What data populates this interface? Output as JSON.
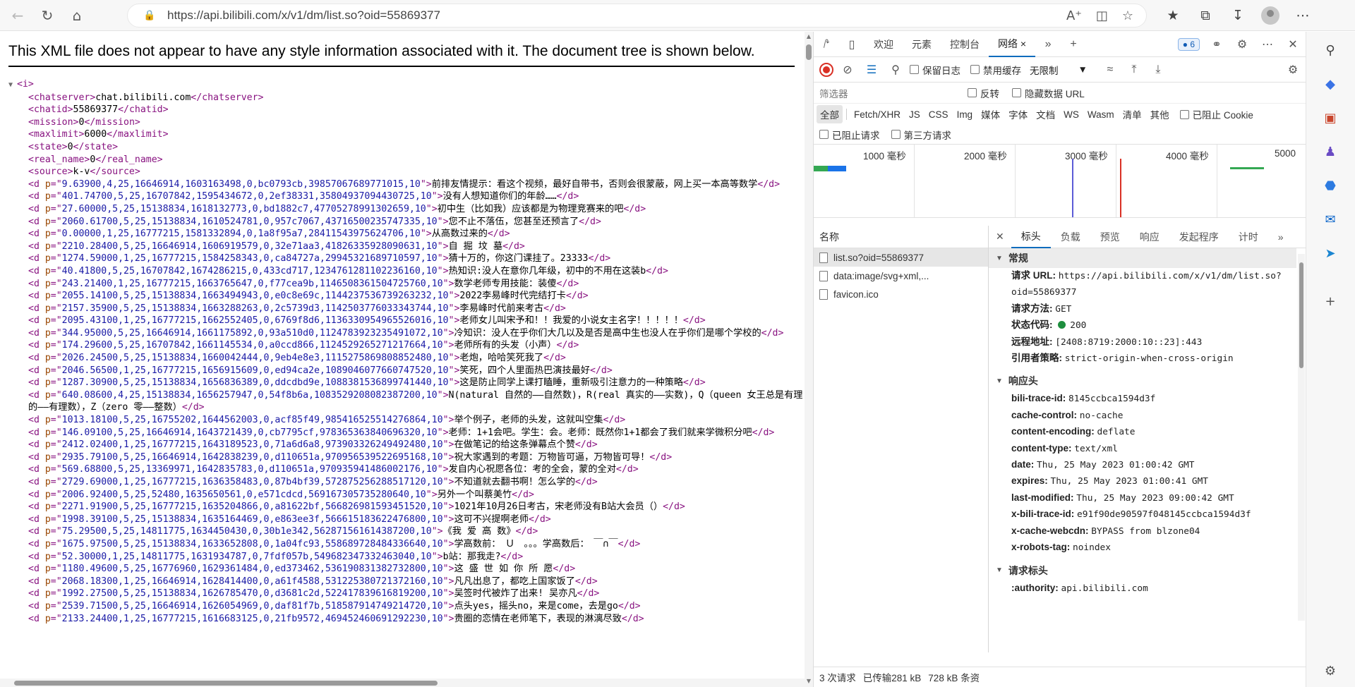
{
  "browser": {
    "url": "https://api.bilibili.com/x/v1/dm/list.so?oid=55869377"
  },
  "xml": {
    "notice": "This XML file does not appear to have any style information associated with it. The document tree is shown below.",
    "root_tag": "i",
    "meta": [
      {
        "tag": "chatserver",
        "value": "chat.bilibili.com"
      },
      {
        "tag": "chatid",
        "value": "55869377"
      },
      {
        "tag": "mission",
        "value": "0"
      },
      {
        "tag": "maxlimit",
        "value": "6000"
      },
      {
        "tag": "state",
        "value": "0"
      },
      {
        "tag": "real_name",
        "value": "0"
      },
      {
        "tag": "source",
        "value": "k-v"
      }
    ],
    "danmaku": [
      {
        "p": "9.63900,4,25,16646914,1603163498,0,bc0793cb,39857067689771015,10",
        "text": "前排友情提示：看这个视频，最好自带书，否则会很蒙蔽，网上买一本高等数学"
      },
      {
        "p": "401.74700,5,25,16707842,1595434672,0,2ef38331,35804937094430725,10",
        "text": "没有人想知道你们的年龄……"
      },
      {
        "p": "27.60000,5,25,15138834,1618132773,0,bd1882c7,47705278991302659,10",
        "text": "初中生（比如我）应该都是为物理竞赛来的吧"
      },
      {
        "p": "2060.61700,5,25,15138834,1610524781,0,957c7067,43716500235747335,10",
        "text": "您不止不落伍，您甚至还预言了"
      },
      {
        "p": "0.00000,1,25,16777215,1581332894,0,1a8f95a7,28411543975624706,10",
        "text": "从高数过来的"
      },
      {
        "p": "2210.28400,5,25,16646914,1606919579,0,32e71aa3,41826335928090631,10",
        "text": "自 掘 坟 墓"
      },
      {
        "p": "1274.59000,1,25,16777215,1584258343,0,ca84727a,29945321689710597,10",
        "text": "猜十万的，你这门课挂了。23333"
      },
      {
        "p": "40.41800,5,25,16707842,1674286215,0,433cd717,1234761281102236160,10",
        "text": "热知识:没人在意你几年级，初中的不用在这装b"
      },
      {
        "p": "243.21400,1,25,16777215,1663765647,0,f77cea9b,1146508361504725760,10",
        "text": "数学老师专用技能：装傻"
      },
      {
        "p": "2055.14100,5,25,15138834,1663494943,0,e0c8e69c,1144237536739263232,10",
        "text": "2022李易峰时代完结打卡"
      },
      {
        "p": "2157.35900,5,25,15138834,1663288263,0,2c5739d3,1142503776033343744,10",
        "text": "李易峰时代前来考古"
      },
      {
        "p": "2095.43100,1,25,16777215,1662552405,0,6769f8d6,1136330954965526016,10",
        "text": "老师女儿叫宋予和！！我爱的小说女主名字！！！！！"
      },
      {
        "p": "344.95000,5,25,16646914,1661175892,0,93a510d0,1124783923235491072,10",
        "text": "冷知识：没人在乎你们大几以及是否是高中生也没人在乎你们是哪个学校的"
      },
      {
        "p": "174.29600,5,25,16707842,1661145534,0,a0ccd866,1124529265271217664,10",
        "text": "老师所有的头发（小声）"
      },
      {
        "p": "2026.24500,5,25,15138834,1660042444,0,9eb4e8e3,1115275869808852480,10",
        "text": "老炮，哈哈笑死我了"
      },
      {
        "p": "2046.56500,1,25,16777215,1656915609,0,ed94ca2e,1089046077660747520,10",
        "text": "笑死，四个人里面热巴演技最好"
      },
      {
        "p": "1287.30900,5,25,15138834,1656836389,0,ddcdbd9e,1088381536899741440,10",
        "text": "这是防止同学上课打瞌睡，重新吸引注意力的一种策略"
      },
      {
        "p": "640.08600,4,25,15138834,1656257947,0,54f8b6a,1083529208082387200,10",
        "text": "N(natural 自然的——自然数)，R(real 真实的——实数)，Q（queen 女王总是有理的——有理数），Z（zero 零——整数）"
      },
      {
        "p": "1013.18100,5,25,16755202,1644562003,0,acf85f49,985416525514276864,10",
        "text": "举个例子，老师的头发，这就叫空集"
      },
      {
        "p": "146.09100,5,25,16646914,1643721439,0,cb7795cf,978365363840696320,10",
        "text": "老师：1+1会吧。学生：会。老师：既然你1+1都会了我们就来学微积分吧"
      },
      {
        "p": "2412.02400,1,25,16777215,1643189523,0,71a6d6a8,973903326249492480,10",
        "text": "在做笔记的给这条弹幕点个赞"
      },
      {
        "p": "2935.79100,5,25,16646914,1642838239,0,d110651a,970956539522695168,10",
        "text": "祝大家遇到的考题：万物皆可逼，万物皆可导！"
      },
      {
        "p": "569.68800,5,25,13369971,1642835783,0,d110651a,970935941486002176,10",
        "text": "发自内心祝愿各位：考的全会，蒙的全对"
      },
      {
        "p": "2729.69000,1,25,16777215,1636358483,0,87b4bf39,572875256288517120,10",
        "text": "不知道就去翻书啊！怎么学的"
      },
      {
        "p": "2006.92400,5,25,52480,1635650561,0,e571cdcd,569167305735280640,10",
        "text": "另外一个叫蔡美竹"
      },
      {
        "p": "2271.91900,5,25,16777215,1635204866,0,a81622bf,566826981593451520,10",
        "text": "1021年10月26日考古，宋老师没有B站大会员（）"
      },
      {
        "p": "1998.39100,5,25,15138834,1635164469,0,e863ee3f,566615183622476800,10",
        "text": "这可不兴提啊老师"
      },
      {
        "p": "75.29500,5,25,14811775,1634450430,0,30b1e342,562871561614387200,10",
        "text": "《我 爱 高 数》"
      },
      {
        "p": "1675.97500,5,25,15138834,1633652808,0,1a04fc93,558689728484336640,10",
        "text": "学高数前：　Ｕ　。。。学高数后：　￣∩￣"
      },
      {
        "p": "52.30000,1,25,14811775,1631934787,0,7fdf057b,549682347332463040,10",
        "text": "b站：那我走?"
      },
      {
        "p": "1180.49600,5,25,16776960,1629361484,0,ed373462,536190831382732800,10",
        "text": "这 盛 世 如 你 所 愿"
      },
      {
        "p": "2068.18300,1,25,16646914,1628414400,0,a61f4588,531225380721372160,10",
        "text": "凡凡出息了，都吃上国家饭了"
      },
      {
        "p": "1992.27500,5,25,15138834,1626785470,0,d3681c2d,522417839616819200,10",
        "text": "吴签时代被炸了出来! 吴亦凡"
      },
      {
        "p": "2539.71500,5,25,16646914,1626054969,0,daf81f7b,518587914749214720,10",
        "text": "点头yes，摇头no，来是come，去是go"
      },
      {
        "p": "2133.24400,1,25,16777215,1616683125,0,21fb9572,469452460691292230,10",
        "text": "贵圈的恋情在老师笔下，表现的淋漓尽致"
      }
    ]
  },
  "devtools": {
    "tabs": [
      "欢迎",
      "元素",
      "控制台",
      "网络",
      "6"
    ],
    "toolbar": {
      "preserve_log": "保留日志",
      "disable_cache": "禁用缓存",
      "throttle": "无限制"
    },
    "filter": {
      "placeholder": "筛选器",
      "invert": "反转",
      "hide_data_urls": "隐藏数据 URL"
    },
    "types": [
      "全部",
      "Fetch/XHR",
      "JS",
      "CSS",
      "Img",
      "媒体",
      "字体",
      "文档",
      "WS",
      "Wasm",
      "清单",
      "其他"
    ],
    "blocked_cookies": "已阻止 Cookie",
    "blocked_requests": "已阻止请求",
    "third_party": "第三方请求",
    "timeline": [
      "1000 毫秒",
      "2000 毫秒",
      "3000 毫秒",
      "4000 毫秒",
      "5000"
    ],
    "names_header": "名称",
    "requests": [
      "list.so?oid=55869377",
      "data:image/svg+xml,...",
      "favicon.ico"
    ],
    "detail_tabs": [
      "标头",
      "负载",
      "预览",
      "响应",
      "发起程序",
      "计时"
    ],
    "general_title": "常规",
    "general": [
      {
        "k": "请求 URL:",
        "v": "https://api.bilibili.com/x/v1/dm/list.so?oid=55869377"
      },
      {
        "k": "请求方法:",
        "v": "GET"
      },
      {
        "k": "状态代码:",
        "v": "200"
      },
      {
        "k": "远程地址:",
        "v": "[2408:8719:2000:10::23]:443"
      },
      {
        "k": "引用者策略:",
        "v": "strict-origin-when-cross-origin"
      }
    ],
    "response_title": "响应头",
    "response": [
      {
        "k": "bili-trace-id:",
        "v": "8145ccbca1594d3f"
      },
      {
        "k": "cache-control:",
        "v": "no-cache"
      },
      {
        "k": "content-encoding:",
        "v": "deflate"
      },
      {
        "k": "content-type:",
        "v": "text/xml"
      },
      {
        "k": "date:",
        "v": "Thu, 25 May 2023 01:00:42 GMT"
      },
      {
        "k": "expires:",
        "v": "Thu, 25 May 2023 01:00:41 GMT"
      },
      {
        "k": "last-modified:",
        "v": "Thu, 25 May 2023 09:00:42 GMT"
      },
      {
        "k": "x-bili-trace-id:",
        "v": "e91f90de90597f048145ccbca1594d3f"
      },
      {
        "k": "x-cache-webcdn:",
        "v": "BYPASS from blzone04"
      },
      {
        "k": "x-robots-tag:",
        "v": "noindex"
      }
    ],
    "request_title": "请求标头",
    "request": [
      {
        "k": ":authority:",
        "v": "api.bilibili.com"
      }
    ],
    "status": {
      "requests": "3 次请求",
      "transferred": "已传输281 kB",
      "resources": "728 kB 条资"
    }
  }
}
